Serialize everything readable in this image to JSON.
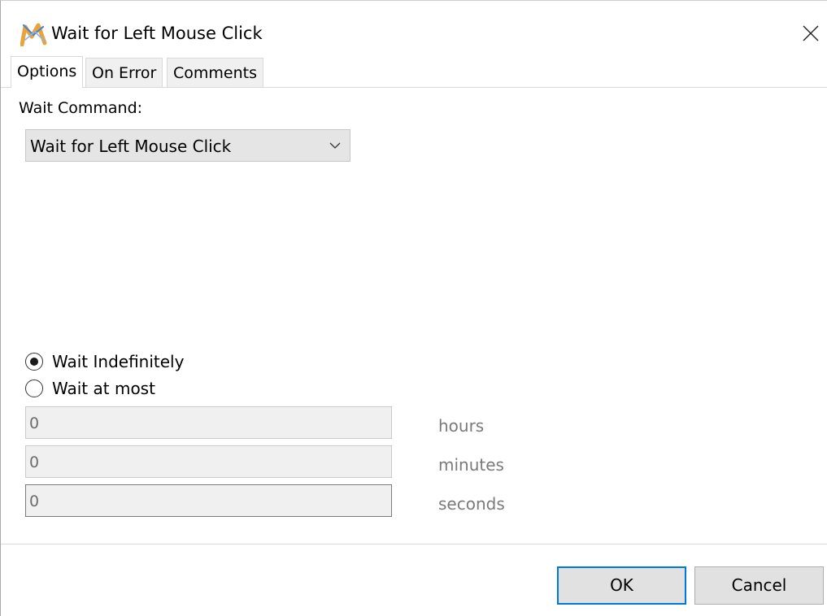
{
  "window": {
    "title": "Wait for Left Mouse Click",
    "app_icon": "app-logo-icon",
    "close_icon": "close-icon"
  },
  "tabs": [
    {
      "label": "Options",
      "active": true
    },
    {
      "label": "On Error",
      "active": false
    },
    {
      "label": "Comments",
      "active": false
    }
  ],
  "wait_command": {
    "label": "Wait Command:",
    "selected": "Wait for Left Mouse Click",
    "chevron_icon": "chevron-down-icon"
  },
  "wait_mode": {
    "options": [
      {
        "label": "Wait Indefinitely",
        "checked": true
      },
      {
        "label": "Wait at most",
        "checked": false
      }
    ]
  },
  "timeouts": [
    {
      "value": "0",
      "unit": "hours"
    },
    {
      "value": "0",
      "unit": "minutes"
    },
    {
      "value": "0",
      "unit": "seconds"
    }
  ],
  "buttons": {
    "ok": "OK",
    "cancel": "Cancel"
  },
  "colors": {
    "accent": "#0078d7",
    "disabled_text": "#7a7a7a"
  }
}
